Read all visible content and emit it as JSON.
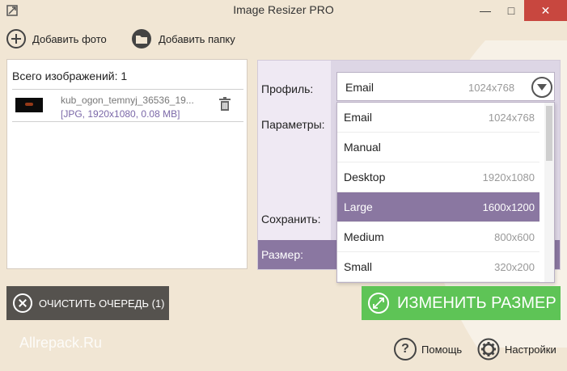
{
  "window": {
    "title": "Image Resizer PRO",
    "minimize_glyph": "—",
    "maximize_glyph": "□",
    "close_glyph": "✕"
  },
  "toolbar": {
    "add_photo_label": "Добавить фото",
    "add_folder_label": "Добавить папку"
  },
  "queue": {
    "count_label": "Всего изображений: 1",
    "files": [
      {
        "name": "kub_ogon_temnyj_36536_19...",
        "info": "[JPG, 1920x1080, 0.08 MB]"
      }
    ]
  },
  "settings": {
    "profile_label": "Профиль:",
    "params_label": "Параметры:",
    "save_label": "Сохранить:",
    "size_label": "Размер:",
    "profile_value": "Email",
    "profile_dimensions": "1024x768"
  },
  "dropdown": {
    "items": [
      {
        "label": "Email",
        "dim": "1024x768"
      },
      {
        "label": "Manual",
        "dim": ""
      },
      {
        "label": "Desktop",
        "dim": "1920x1080"
      },
      {
        "label": "Large",
        "dim": "1600x1200"
      },
      {
        "label": "Medium",
        "dim": "800x600"
      },
      {
        "label": "Small",
        "dim": "320x200"
      }
    ],
    "selected_index": 3
  },
  "actions": {
    "clear_queue_label": "ОЧИСТИТЬ ОЧЕРЕДЬ (1)",
    "resize_label": "ИЗМЕНИТЬ РАЗМЕР"
  },
  "footer": {
    "watermark": "Allrepack.Ru",
    "help_label": "Помощь",
    "help_glyph": "?",
    "settings_label": "Настройки"
  },
  "colors": {
    "background": "#f1e6d4",
    "accent_purple": "#8a77a1",
    "resize_green": "#5ec456",
    "clear_dark": "#55524e",
    "close_red": "#c8473f"
  },
  "icons": [
    "app-icon",
    "plus-icon",
    "folder-icon",
    "trash-icon",
    "chevron-down-icon",
    "close-circle-icon",
    "resize-icon",
    "help-icon",
    "gear-icon"
  ]
}
